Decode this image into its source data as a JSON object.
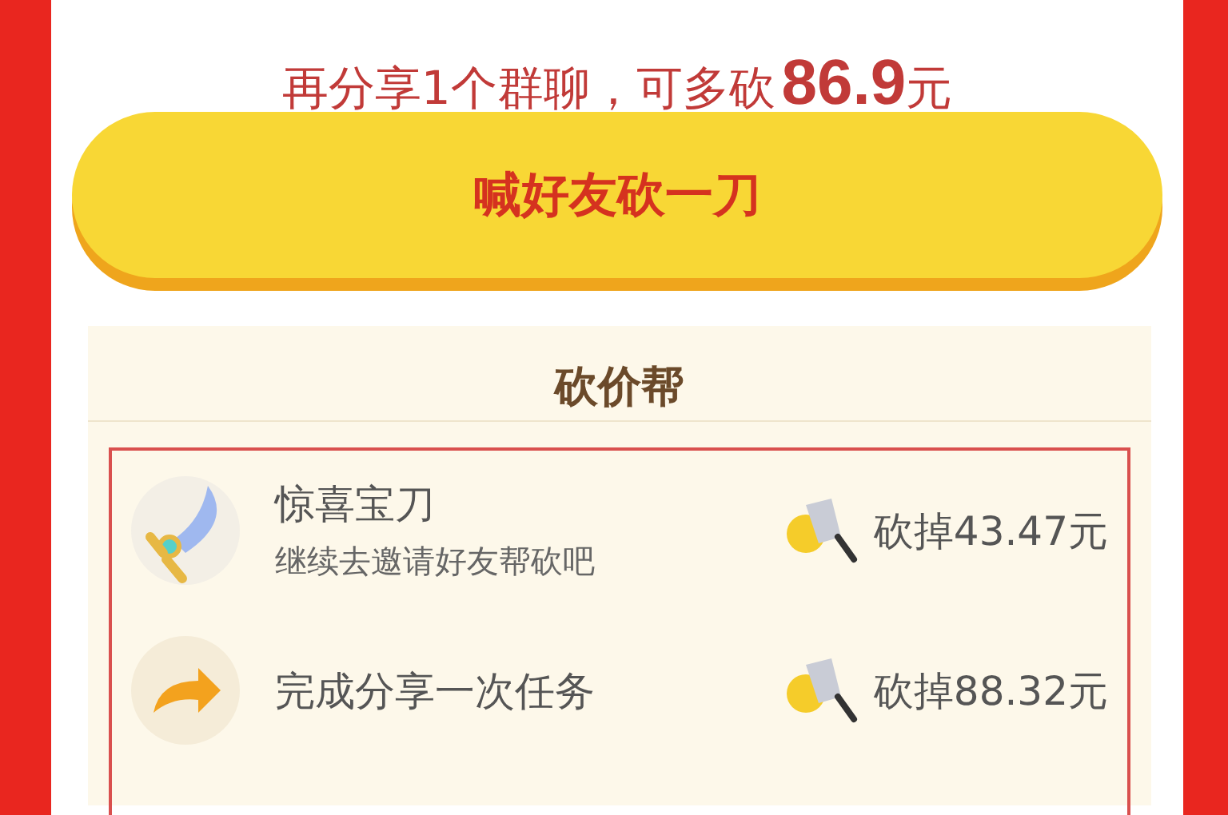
{
  "share_hint": {
    "text": "再分享1个群聊，可多砍",
    "amount": "86.9",
    "unit": "元"
  },
  "invite_button": {
    "label": "喊好友砍一刀"
  },
  "helpers": {
    "title": "砍价帮",
    "items": [
      {
        "kind": "sword",
        "name": "惊喜宝刀",
        "note": "继续去邀请好友帮砍吧",
        "cut": "砍掉43.47元"
      },
      {
        "kind": "share",
        "name": "完成分享一次任务",
        "cut": "砍掉88.32元"
      }
    ]
  }
}
